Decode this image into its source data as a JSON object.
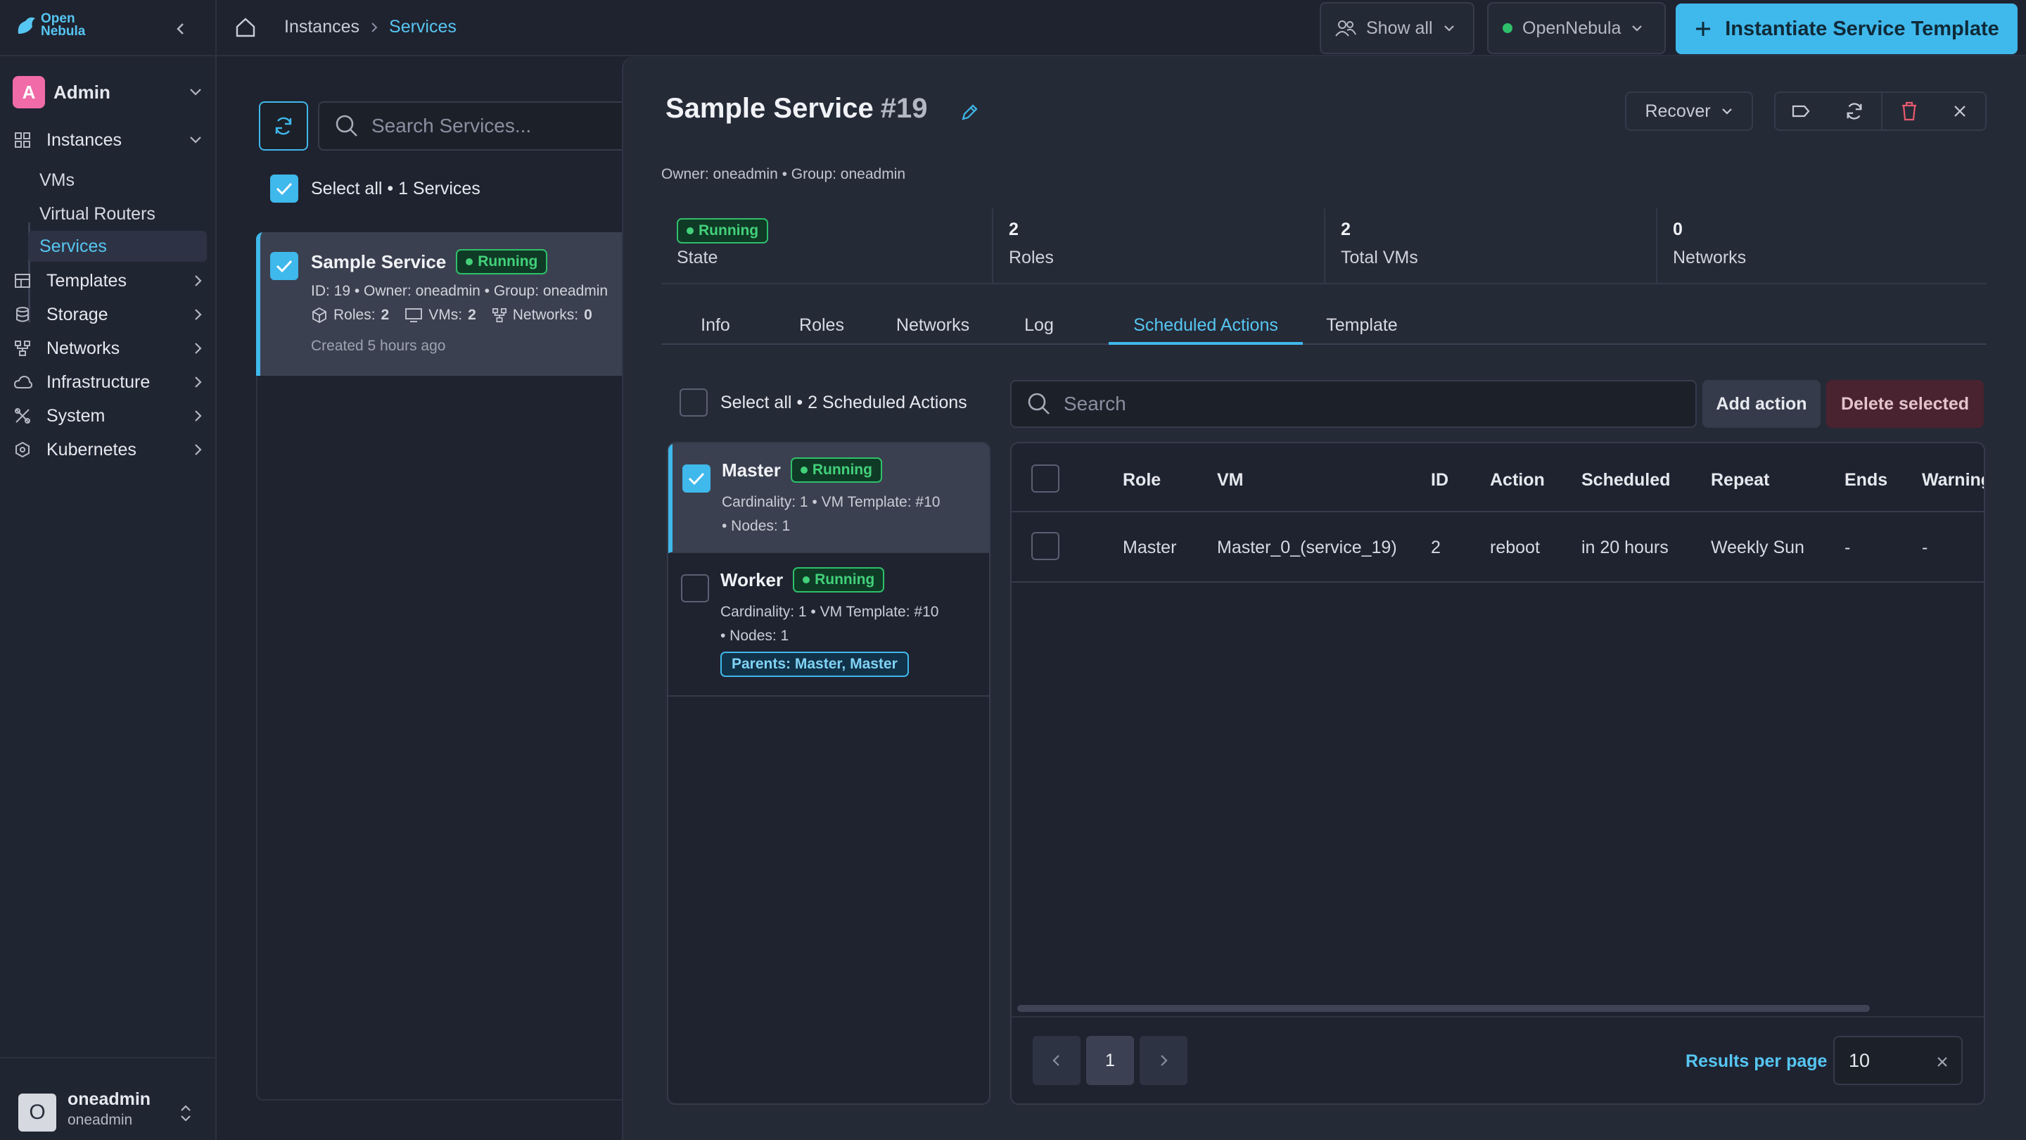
{
  "brand": {
    "name_line1": "Open",
    "name_line2": "Nebula",
    "accent": "#3fb8eb"
  },
  "breadcrumb": {
    "items": [
      "Instances",
      "Services"
    ]
  },
  "header": {
    "show_all": "Show all",
    "zone": "OpenNebula",
    "zone_status_color": "#2fbf6a",
    "instantiate_label": "Instantiate Service Template"
  },
  "sidebar": {
    "user_group": {
      "initial": "A",
      "name": "Admin"
    },
    "items": [
      {
        "label": "Instances",
        "icon": "grid-icon"
      },
      {
        "label": "Templates",
        "icon": "template-icon"
      },
      {
        "label": "Storage",
        "icon": "database-icon"
      },
      {
        "label": "Networks",
        "icon": "network-icon"
      },
      {
        "label": "Infrastructure",
        "icon": "cloud-icon"
      },
      {
        "label": "System",
        "icon": "tools-icon"
      },
      {
        "label": "Kubernetes",
        "icon": "kubernetes-icon"
      }
    ],
    "subitems": [
      "VMs",
      "Virtual Routers",
      "Services"
    ],
    "user": {
      "initial": "O",
      "name": "oneadmin",
      "sub": "oneadmin"
    }
  },
  "services_list": {
    "search_placeholder": "Search Services...",
    "select_all": "Select all • 1 Services",
    "card": {
      "name": "Sample Service",
      "status": "Running",
      "meta": "ID: 19 • Owner: oneadmin • Group: oneadmin",
      "roles_label": "Roles:",
      "roles": "2",
      "vms_label": "VMs:",
      "vms": "2",
      "networks_label": "Networks:",
      "networks": "0",
      "created": "Created 5 hours ago"
    }
  },
  "detail": {
    "title": "Sample Service",
    "id": "#19",
    "owner_line": "Owner: oneadmin • Group: oneadmin",
    "recover_label": "Recover",
    "stats": [
      {
        "value": "Running",
        "label": "State"
      },
      {
        "value": "2",
        "label": "Roles"
      },
      {
        "value": "2",
        "label": "Total VMs"
      },
      {
        "value": "0",
        "label": "Networks"
      }
    ],
    "tabs": [
      "Info",
      "Roles",
      "Networks",
      "Log",
      "Scheduled Actions",
      "Template"
    ],
    "active_tab": "Scheduled Actions"
  },
  "scheduled": {
    "select_all": "Select all • 2 Scheduled Actions",
    "search_placeholder": "Search",
    "add_label": "Add action",
    "delete_label": "Delete selected",
    "roles": [
      {
        "name": "Master",
        "status": "Running",
        "meta1": "Cardinality: 1 • VM Template: #10",
        "meta2": "• Nodes: 1",
        "checked": true
      },
      {
        "name": "Worker",
        "status": "Running",
        "meta1": "Cardinality: 1 • VM Template: #10",
        "meta2": "• Nodes: 1",
        "parents": "Parents: Master, Master",
        "checked": false
      }
    ],
    "columns": [
      "Role",
      "VM",
      "ID",
      "Action",
      "Scheduled",
      "Repeat",
      "Ends",
      "Warning"
    ],
    "rows": [
      {
        "role": "Master",
        "vm": "Master_0_(service_19)",
        "id": "2",
        "action": "reboot",
        "scheduled": "in 20 hours",
        "repeat": "Weekly Sun",
        "ends": "-",
        "warning": "-"
      }
    ],
    "pagination": {
      "current_page": "1",
      "results_per_page_label": "Results per page",
      "results_per_page": "10"
    }
  }
}
